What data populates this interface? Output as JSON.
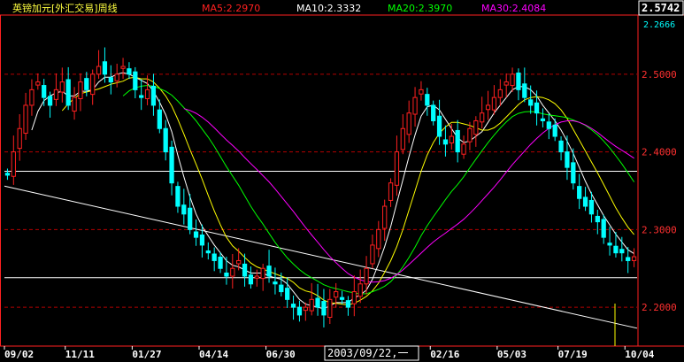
{
  "chart_data": {
    "type": "candlestick",
    "title": "英镑加元[外汇交易]周线",
    "price_readout": "2.5742",
    "price_tag": "2.2666",
    "cursor_date": "2003/09/22,一",
    "ylim": [
      2.15,
      2.575
    ],
    "y_ticks": [
      "2.5000",
      "2.4000",
      "2.3000",
      "2.2000"
    ],
    "y_tick_values": [
      2.5,
      2.4,
      2.3,
      2.2
    ],
    "x_ticks": [
      "09/02",
      "11/11",
      "01/27",
      "04/14",
      "06/30",
      "09/",
      "02/16",
      "05/03",
      "07/19",
      "10/04"
    ],
    "x_tick_weeks": [
      0,
      10,
      21,
      32,
      43,
      54,
      70,
      81,
      91,
      102
    ],
    "weeks": 104,
    "grid": true,
    "colors": {
      "up": "#ff2020",
      "down": "#00ffff",
      "ma5": "#ffffff",
      "ma10": "#ffff00",
      "ma20": "#00ff00",
      "ma30": "#ff00ff",
      "grid": "#b40000",
      "trend": "#ffffff"
    },
    "ma_legend": [
      {
        "name": "MA5",
        "label": "MA5:2.2970",
        "color": "#ff2020"
      },
      {
        "name": "MA10",
        "label": "MA10:2.3332",
        "color": "#ffffff"
      },
      {
        "name": "MA20",
        "label": "MA20:2.3970",
        "color": "#00ff00"
      },
      {
        "name": "MA30",
        "label": "MA30:2.4084",
        "color": "#ff00ff"
      }
    ],
    "horizontal_lines": [
      2.375,
      2.238
    ],
    "trendline": {
      "from": [
        0,
        2.356
      ],
      "to": [
        104,
        2.173
      ]
    },
    "closes": [
      2.37,
      2.4,
      2.43,
      2.46,
      2.48,
      2.49,
      2.47,
      2.46,
      2.48,
      2.49,
      2.46,
      2.47,
      2.49,
      2.48,
      2.5,
      2.51,
      2.5,
      2.49,
      2.5,
      2.51,
      2.5,
      2.48,
      2.47,
      2.48,
      2.46,
      2.43,
      2.4,
      2.36,
      2.33,
      2.32,
      2.3,
      2.29,
      2.28,
      2.27,
      2.26,
      2.25,
      2.24,
      2.25,
      2.26,
      2.24,
      2.23,
      2.24,
      2.25,
      2.24,
      2.23,
      2.22,
      2.21,
      2.2,
      2.19,
      2.2,
      2.21,
      2.2,
      2.19,
      2.21,
      2.22,
      2.21,
      2.2,
      2.22,
      2.23,
      2.25,
      2.28,
      2.3,
      2.33,
      2.36,
      2.4,
      2.43,
      2.45,
      2.47,
      2.48,
      2.46,
      2.44,
      2.42,
      2.41,
      2.42,
      2.4,
      2.41,
      2.43,
      2.44,
      2.45,
      2.46,
      2.47,
      2.48,
      2.49,
      2.5,
      2.48,
      2.47,
      2.46,
      2.45,
      2.44,
      2.43,
      2.42,
      2.4,
      2.38,
      2.36,
      2.34,
      2.33,
      2.32,
      2.31,
      2.29,
      2.28,
      2.27,
      2.27,
      2.26,
      2.265
    ]
  }
}
